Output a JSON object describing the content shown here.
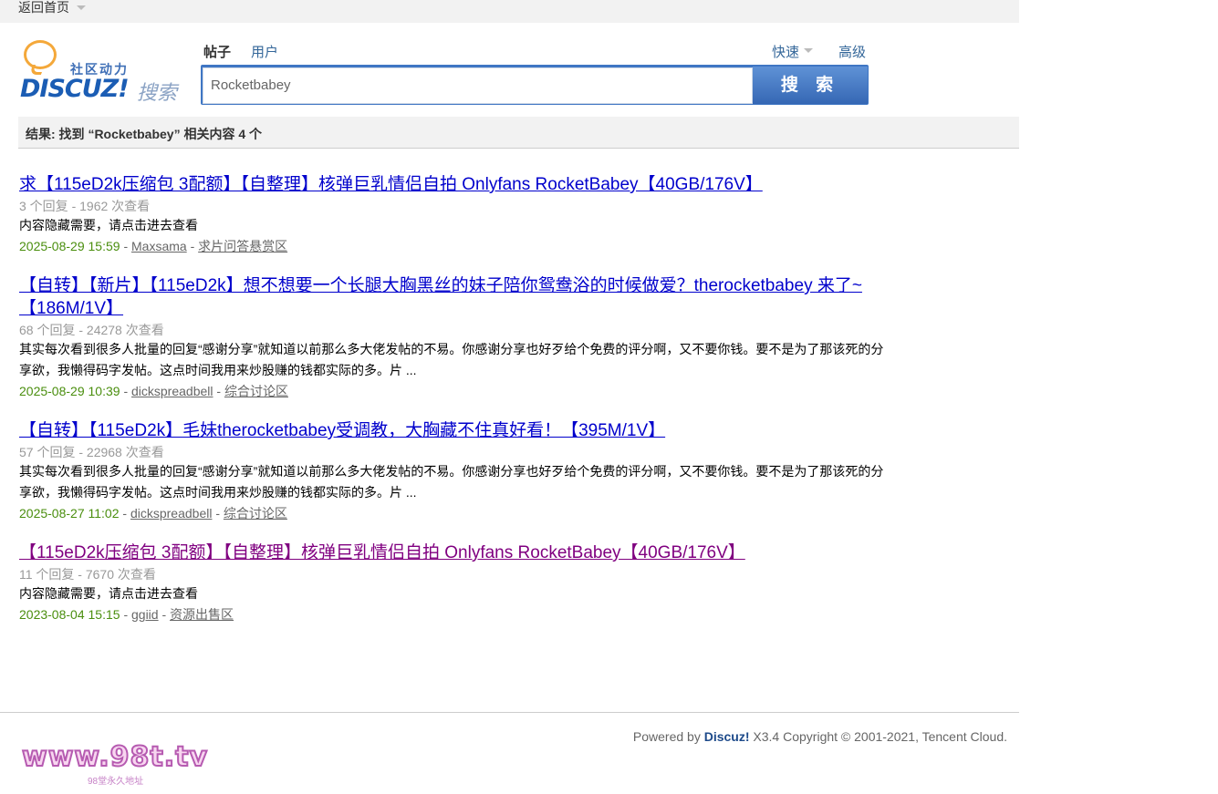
{
  "topbar": {
    "home_label": "返回首页"
  },
  "logo": {
    "tagline": "社区动力",
    "brand": "DISCUZ!",
    "search_word": "搜索"
  },
  "search": {
    "tabs": {
      "posts": "帖子",
      "users": "用户",
      "fast": "快速",
      "advanced": "高级"
    },
    "query": "Rocketbabey",
    "button_label": "搜 索"
  },
  "results_header": "结果: 找到 “Rocketbabey” 相关内容 4 个",
  "results": [
    {
      "title": "求【115eD2k压缩包 3配额】【自整理】核弹巨乳情侣自拍 Onlyfans RocketBabey【40GB/176V】",
      "stats": "3 个回复 - 1962 次查看",
      "desc": "内容隐藏需要，请点击进去查看",
      "date": "2025-08-29 15:59",
      "author": "Maxsama",
      "forum": "求片问答悬赏区",
      "visited": false
    },
    {
      "title": "【自转】【新片】【115eD2k】想不想要一个长腿大胸黑丝的妹子陪你鸳鸯浴的时候做爱？therocketbabey 来了~【186M/1V】",
      "stats": "68 个回复 - 24278 次查看",
      "desc": "其实每次看到很多人批量的回复“感谢分享”就知道以前那么多大佬发帖的不易。你感谢分享也好歹给个免费的评分啊，又不要你钱。要不是为了那该死的分享欲，我懒得码字发帖。这点时间我用来炒股赚的钱都实际的多。片 ...",
      "date": "2025-08-29 10:39",
      "author": "dickspreadbell",
      "forum": "综合讨论区",
      "visited": false
    },
    {
      "title": "【自转】【115eD2k】毛妹therocketbabey受调教，大胸藏不住真好看！【395M/1V】",
      "stats": "57 个回复 - 22968 次查看",
      "desc": "其实每次看到很多人批量的回复“感谢分享”就知道以前那么多大佬发帖的不易。你感谢分享也好歹给个免费的评分啊，又不要你钱。要不是为了那该死的分享欲，我懒得码字发帖。这点时间我用来炒股赚的钱都实际的多。片 ...",
      "date": "2025-08-27 11:02",
      "author": "dickspreadbell",
      "forum": "综合讨论区",
      "visited": false
    },
    {
      "title": "【115eD2k压缩包 3配额】【自整理】核弹巨乳情侣自拍 Onlyfans RocketBabey【40GB/176V】",
      "stats": "11 个回复 - 7670 次查看",
      "desc": "内容隐藏需要，请点击进去查看",
      "date": "2023-08-04 15:15",
      "author": "ggiid",
      "forum": "资源出售区",
      "visited": true
    }
  ],
  "footer": {
    "powered_prefix": "Powered by",
    "powered_brand": "Discuz!",
    "powered_rest": "X3.4   Copyright © 2001-2021, Tencent Cloud.",
    "site_logo": "www.98t.tv",
    "site_logo_sub": "98堂永久地址"
  }
}
